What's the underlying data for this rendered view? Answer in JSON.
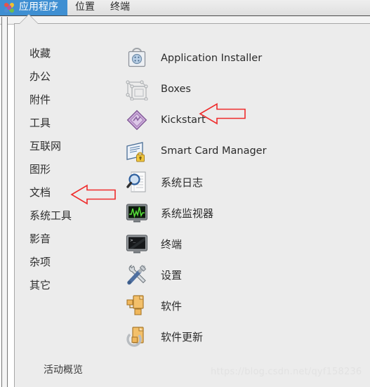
{
  "menubar": {
    "items": [
      {
        "label": "应用程序",
        "icon": "gnome-pinwheel-icon",
        "active": true
      },
      {
        "label": "位置",
        "icon": "",
        "active": false
      },
      {
        "label": "终端",
        "icon": "",
        "active": false
      }
    ],
    "active_bg": "#3f8fd2"
  },
  "popup": {
    "categories": [
      {
        "label": "收藏"
      },
      {
        "label": "办公"
      },
      {
        "label": "附件"
      },
      {
        "label": "工具"
      },
      {
        "label": "互联网"
      },
      {
        "label": "图形"
      },
      {
        "label": "文档"
      },
      {
        "label": "系统工具"
      },
      {
        "label": "影音"
      },
      {
        "label": "杂项"
      },
      {
        "label": "其它"
      }
    ],
    "apps": [
      {
        "label": "Application Installer",
        "icon": "package-installer-icon"
      },
      {
        "label": "Boxes",
        "icon": "boxes-icon"
      },
      {
        "label": "Kickstart",
        "icon": "kickstart-diamond-icon"
      },
      {
        "label": "Smart Card Manager",
        "icon": "smart-card-lock-icon"
      },
      {
        "label": "系统日志",
        "icon": "log-magnifier-icon"
      },
      {
        "label": "系统监视器",
        "icon": "system-monitor-icon"
      },
      {
        "label": "终端",
        "icon": "terminal-icon"
      },
      {
        "label": "设置",
        "icon": "settings-tools-icon"
      },
      {
        "label": "软件",
        "icon": "software-package-icon"
      },
      {
        "label": "软件更新",
        "icon": "software-update-icon"
      }
    ],
    "overview_label": "活动概览"
  },
  "annotations": {
    "color": "#ef2b2b",
    "arrows": [
      {
        "name": "arrow-pointing-to-kickstart",
        "points_to": "Kickstart"
      },
      {
        "name": "arrow-pointing-to-system-tools",
        "points_to": "系统工具"
      }
    ]
  },
  "watermark": {
    "text": "https://blog.csdn.net/qyf158236"
  }
}
